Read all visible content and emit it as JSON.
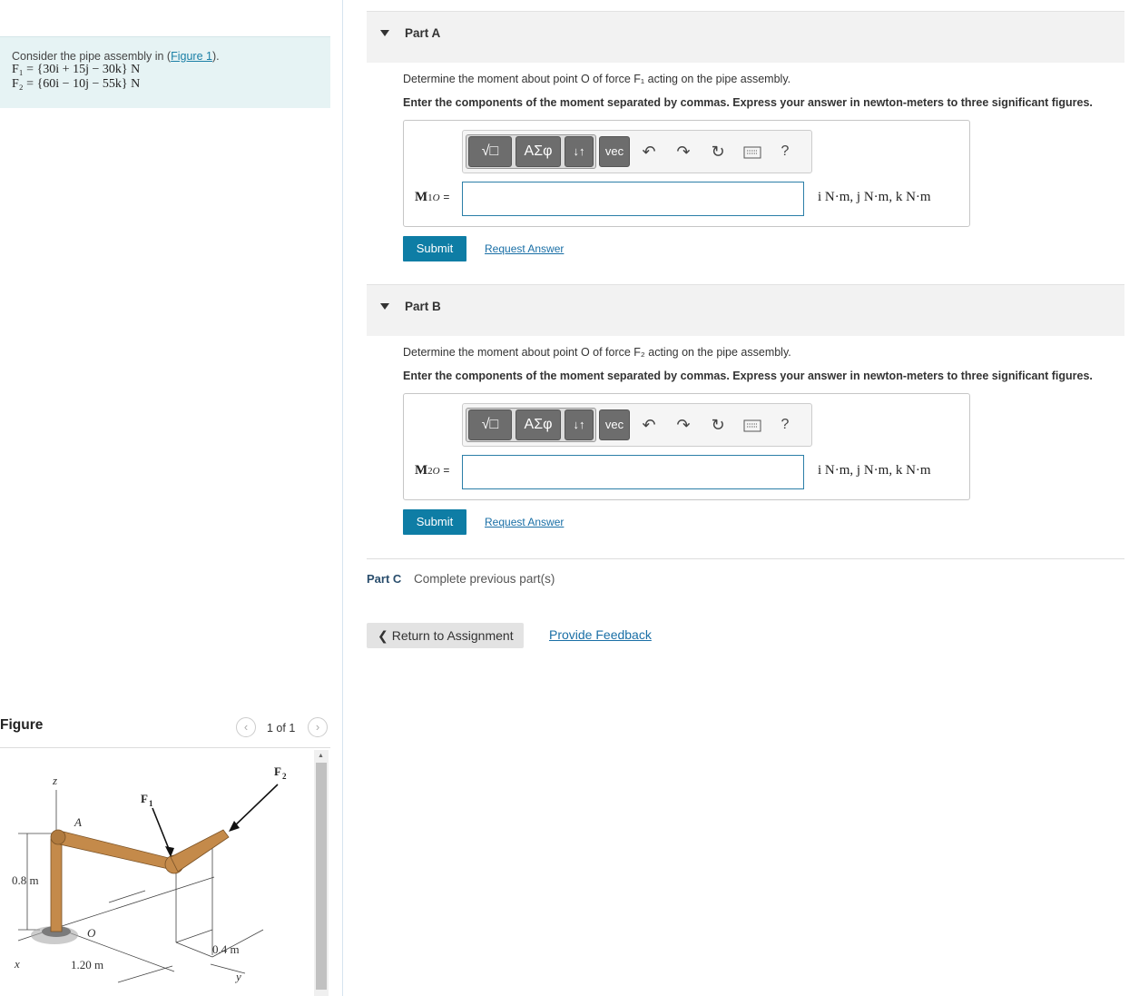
{
  "problem": {
    "intro": "Consider the pipe assembly in (",
    "figure_link": "Figure 1",
    "intro_end": ").",
    "f1": "F₁ = {30i + 15j − 30k} N",
    "f2": "F₂ = {60i − 10j − 55k} N"
  },
  "figure_panel": {
    "title": "Figure",
    "counter": "1 of 1",
    "labels": {
      "z": "z",
      "A": "A",
      "O": "O",
      "x": "x",
      "y": "y",
      "F1": "F",
      "F1_sub": "1",
      "F2": "F",
      "F2_sub": "2",
      "dim_08": "0.8 m",
      "dim_120": "1.20 m",
      "dim_04": "0.4 m"
    }
  },
  "parts": [
    {
      "title": "Part A",
      "question": "Determine the moment about point O of force F₁ acting on the pipe assembly.",
      "instruction": "Enter the components of the moment separated by commas. Express your answer in newton-meters to three significant figures.",
      "var_label": "M1O",
      "units": "i N·m, j N·m, k N·m",
      "input_value": "",
      "submit": "Submit",
      "request": "Request Answer"
    },
    {
      "title": "Part B",
      "question": "Determine the moment about point O of force F₂ acting on the pipe assembly.",
      "instruction": "Enter the components of the moment separated by commas. Express your answer in newton-meters to three significant figures.",
      "var_label": "M2O",
      "units": "i N·m, j N·m, k N·m",
      "input_value": "",
      "submit": "Submit",
      "request": "Request Answer"
    }
  ],
  "toolbar": {
    "templates": "√□",
    "greek": "ΑΣφ",
    "arrows": "↓↑",
    "vec": "vec",
    "undo": "↶",
    "redo": "↷",
    "reset": "↻",
    "keyboard": "keyboard",
    "help": "?"
  },
  "part_c": {
    "title": "Part C",
    "desc": "Complete previous part(s)"
  },
  "footer": {
    "return": "Return to Assignment",
    "feedback": "Provide Feedback"
  }
}
